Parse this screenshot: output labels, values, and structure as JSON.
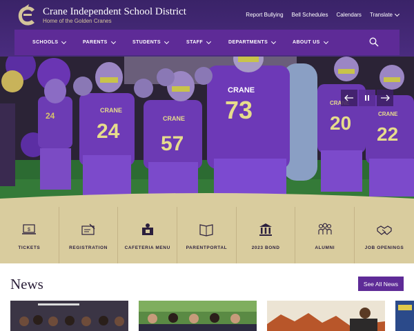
{
  "header": {
    "district_name": "Crane Independent School District",
    "tagline": "Home of the Golden Cranes",
    "logo_icon": "crane-c-logo-icon",
    "utility_links": [
      "Report Bullying",
      "Bell Schedules",
      "Calendars",
      "Translate"
    ]
  },
  "nav": {
    "items": [
      "SCHOOLS",
      "PARENTS",
      "STUDENTS",
      "STAFF",
      "DEPARTMENTS",
      "ABOUT US"
    ],
    "search_icon": "search-icon"
  },
  "hero": {
    "jerseys": [
      "CRANE",
      "73",
      "24",
      "57",
      "20",
      "22",
      "24"
    ],
    "controls": [
      "prev-arrow-icon",
      "pause-icon",
      "next-arrow-icon"
    ]
  },
  "quicklinks": {
    "items": [
      {
        "label": "TICKETS",
        "icon": "laptop-ticket-icon"
      },
      {
        "label": "REGISTRATION",
        "icon": "registration-card-icon"
      },
      {
        "label": "CAFETERIA MENU",
        "icon": "cafeteria-menu-icon"
      },
      {
        "label": "PARENTPORTAL",
        "icon": "parent-portal-icon"
      },
      {
        "label": "2023 BOND",
        "icon": "bond-building-icon"
      },
      {
        "label": "ALUMNI",
        "icon": "alumni-group-icon"
      },
      {
        "label": "JOB OPENINGS",
        "icon": "handshake-icon"
      }
    ]
  },
  "news": {
    "title": "News",
    "see_all_label": "See All News"
  },
  "colors": {
    "purple": "#5e2b97",
    "dark_purple": "#3a2368",
    "gold": "#d4c59a",
    "tan": "#d9cc9e"
  }
}
